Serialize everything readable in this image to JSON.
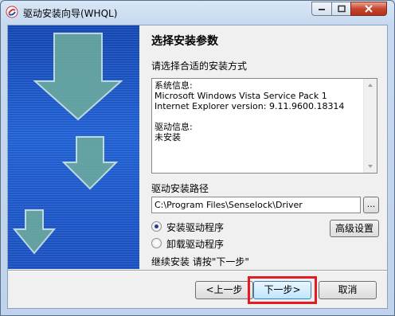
{
  "window": {
    "title": "驱动安装向导(WHQL)",
    "icon": "app-logo-icon",
    "controls": [
      "minimize-icon",
      "maximize-icon",
      "close-icon"
    ]
  },
  "page": {
    "heading": "选择安装参数",
    "subheading": "请选择合适的安装方式"
  },
  "info_box": {
    "lines": [
      "系统信息:",
      "Microsoft Windows Vista Service Pack 1",
      "Internet Explorer version: 9.11.9600.18314",
      "",
      "驱动信息:",
      "未安装"
    ]
  },
  "install_path": {
    "label": "驱动安装路径",
    "value": "C:\\Program Files\\Senselock\\Driver",
    "browse_label": "..."
  },
  "options": {
    "install_label": "安装驱动程序",
    "uninstall_label": "卸载驱动程序",
    "selected": "install",
    "advanced_label": "高级设置"
  },
  "hint": "继续安装 请按\"下一步\"",
  "buttons": {
    "prev": "<上一步",
    "next": "下一步>",
    "cancel": "取消"
  },
  "colors": {
    "highlight": "#e31c23",
    "banner_blue": "#1a4fbf",
    "arrow_fill": "#6fae9c"
  }
}
